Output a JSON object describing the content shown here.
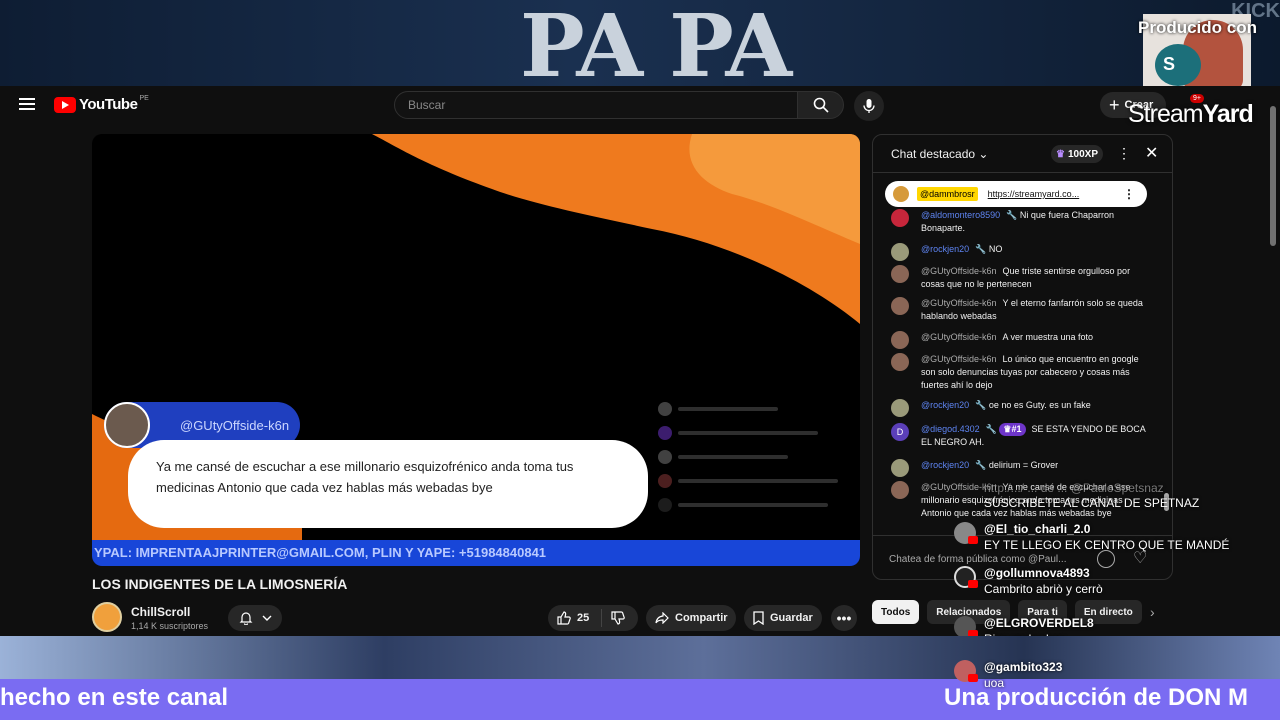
{
  "banner": {
    "title": "PA PA",
    "kick": "KICK",
    "producido": "Producido con",
    "streamyard_a": "Stream",
    "streamyard_b": "Yard"
  },
  "youtube": {
    "logo_text": "YouTube",
    "country": "PE",
    "search_placeholder": "Buscar",
    "create_label": "Crear",
    "notif_count": "9+"
  },
  "video": {
    "bubble_user": "@GUtyOffside-k6n",
    "bubble_text": "Ya me cansé de escuchar a ese millonario esquizofrénico anda toma tus medicinas Antonio que cada vez hablas más webadas bye",
    "ticker": "YPAL: IMPRENTAAJPRINTER@GMAIL.COM, PLIN Y YAPE: +51984840841",
    "title": "LOS INDIGENTES DE LA LIMOSNERÍA",
    "channel": "ChillScroll",
    "subscribers": "1,14 K suscriptores",
    "likes": "25",
    "share": "Compartir",
    "save": "Guardar"
  },
  "chat": {
    "title": "Chat destacado",
    "xp": "100XP",
    "pinned_user": "@dammbrosr",
    "pinned_link": "https://streamyard.co...",
    "messages": [
      {
        "user": "@aldomontero8590",
        "text": "Ni que fuera Chaparron Bonaparte.",
        "mod": true
      },
      {
        "user": "@rockjen20",
        "text": "NO",
        "mod": true
      },
      {
        "user": "@GUtyOffside-k6n",
        "text": "Que triste sentirse orgulloso por cosas que no le pertenecen",
        "mod": false
      },
      {
        "user": "@GUtyOffside-k6n",
        "text": "Y el eterno fanfarrón solo se queda hablando webadas",
        "mod": false
      },
      {
        "user": "@GUtyOffside-k6n",
        "text": "A ver muestra una foto",
        "mod": false
      },
      {
        "user": "@GUtyOffside-k6n",
        "text": "Lo único que encuentro en google son solo denuncias tuyas por cabecero y cosas más fuertes ahí lo dejo",
        "mod": false
      },
      {
        "user": "@rockjen20",
        "text": "oe no es Guty. es un fake",
        "mod": true
      },
      {
        "user": "@diegod.4302",
        "badge": "#1",
        "text": "SE ESTA YENDO DE BOCA EL NEGRO AH.",
        "mod": true
      },
      {
        "user": "@rockjen20",
        "text": "delirium = Grover",
        "mod": true
      },
      {
        "user": "@GUtyOffside-k6n",
        "text": "Ya me cansé de escuchar a ese millonario esquizofrénico anda toma tus medicinas Antonio que cada vez hablas más webadas bye",
        "mod": false
      }
    ],
    "input_placeholder": "Chatea de forma pública como @Paul..."
  },
  "chips": [
    "Todos",
    "Relacionados",
    "Para ti",
    "En directo"
  ],
  "overlay": {
    "faint": "http:/.../ ...  de ...  @PauloSpetsnaz",
    "suscribete": "SUSCRIBETE AL CANAL DE SPETNAZ",
    "messages": [
      {
        "name": "@El_tio_charli_2.0",
        "text": "EY TE LLEGO EK CENTRO QUE TE MANDÉ"
      },
      {
        "name": "@gollumnova4893",
        "text": "Cambrito abriò y cerrò"
      },
      {
        "name": "@ELGROVERDEL8",
        "text": "Rica grabadora"
      },
      {
        "name": "@gambito323",
        "text": "uoa"
      }
    ],
    "bottom_left": "hecho en este canal",
    "bottom_right": "Una producción de DON M"
  },
  "colors": {
    "accent": "#ff0000",
    "chip_active": "#f1f1f1",
    "strip": "#7a6cf2",
    "ticker": "#1846d8"
  }
}
